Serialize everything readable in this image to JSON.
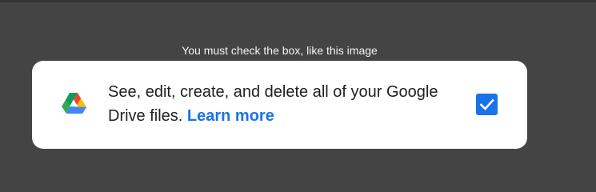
{
  "instruction_text": "You must check the box, like this image",
  "permission": {
    "icon": "google-drive-icon",
    "description": "See, edit, create, and delete all of your Google Drive files.",
    "learn_more_label": "Learn more",
    "checked": true
  },
  "colors": {
    "backdrop": "#444444",
    "card": "#ffffff",
    "text": "#202124",
    "link": "#1a73e8",
    "checkbox": "#1a73e8"
  }
}
